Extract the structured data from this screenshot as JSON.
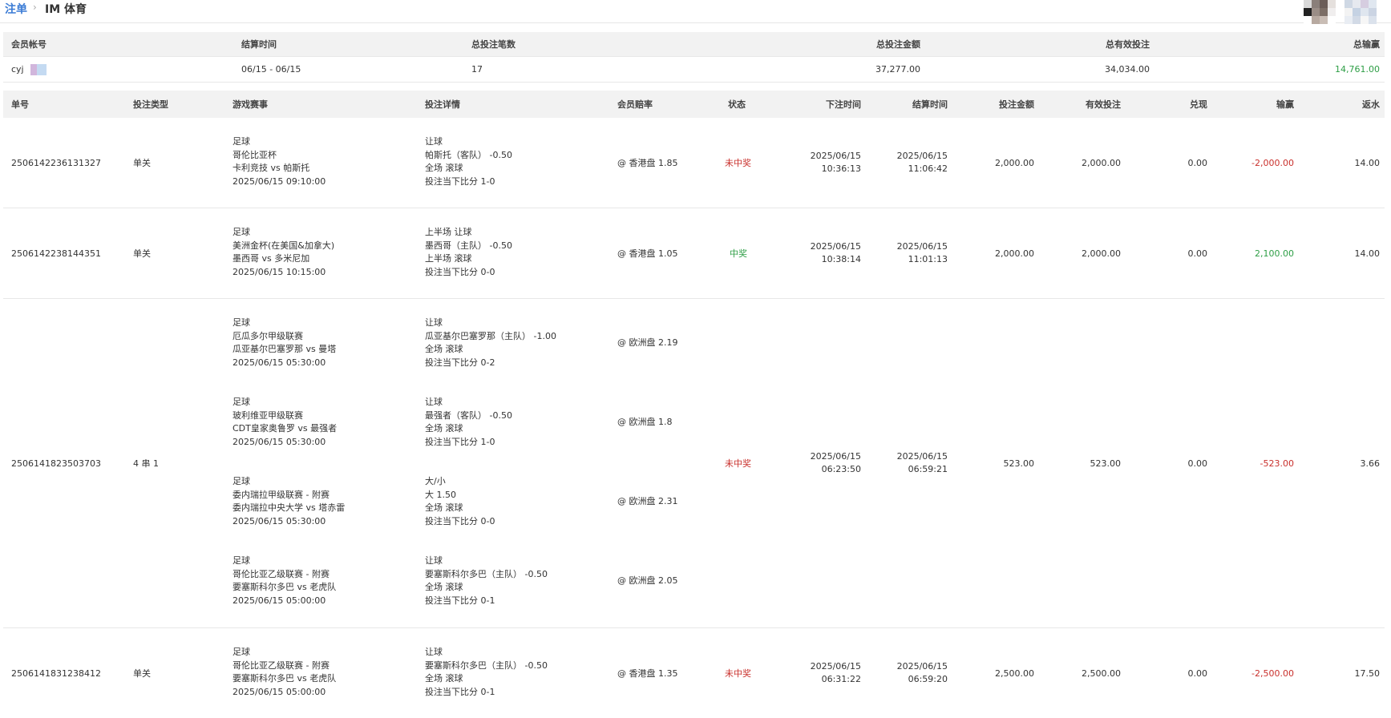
{
  "breadcrumb": {
    "link": "注单",
    "separator": "›",
    "current": "IM 体育"
  },
  "summary": {
    "headers": [
      "会员帐号",
      "结算时间",
      "总投注笔数",
      "总投注金额",
      "总有效投注",
      "总输赢"
    ],
    "account": "cyj",
    "settle_range": "06/15 - 06/15",
    "bet_count": "17",
    "total_bet": "37,277.00",
    "total_valid": "34,034.00",
    "total_winloss": "14,761.00"
  },
  "bets": {
    "headers": [
      "单号",
      "投注类型",
      "游戏赛事",
      "投注详情",
      "会员赔率",
      "状态",
      "下注时间",
      "结算时间",
      "投注金额",
      "有效投注",
      "兑现",
      "输赢",
      "返水"
    ],
    "rows": [
      {
        "id": "2506142236131327",
        "type": "单关",
        "status": "未中奖",
        "bet_date": "2025/06/15",
        "bet_time": "10:36:13",
        "settle_date": "2025/06/15",
        "settle_time": "11:06:42",
        "amount": "2,000.00",
        "valid": "2,000.00",
        "cashout": "0.00",
        "winloss": "-2,000.00",
        "rebate": "14.00",
        "legs": [
          {
            "sport": "足球",
            "league": "哥伦比亚杯",
            "match": "卡利竞技 vs 帕斯托",
            "time": "2025/06/15 09:10:00",
            "market": "让球",
            "selection": "帕斯托（客队） -0.50",
            "period": "全场 滚球",
            "score": "投注当下比分 1-0",
            "odds": "@ 香港盘 1.85"
          }
        ]
      },
      {
        "id": "2506142238144351",
        "type": "单关",
        "status": "中奖",
        "bet_date": "2025/06/15",
        "bet_time": "10:38:14",
        "settle_date": "2025/06/15",
        "settle_time": "11:01:13",
        "amount": "2,000.00",
        "valid": "2,000.00",
        "cashout": "0.00",
        "winloss": "2,100.00",
        "rebate": "14.00",
        "legs": [
          {
            "sport": "足球",
            "league": "美洲金杯(在美国&加拿大)",
            "match": "墨西哥 vs 多米尼加",
            "time": "2025/06/15 10:15:00",
            "market": "上半场 让球",
            "selection": "墨西哥（主队） -0.50",
            "period": "上半场 滚球",
            "score": "投注当下比分 0-0",
            "odds": "@ 香港盘 1.05"
          }
        ]
      },
      {
        "id": "2506141823503703",
        "type": "4 串 1",
        "status": "未中奖",
        "bet_date": "2025/06/15",
        "bet_time": "06:23:50",
        "settle_date": "2025/06/15",
        "settle_time": "06:59:21",
        "amount": "523.00",
        "valid": "523.00",
        "cashout": "0.00",
        "winloss": "-523.00",
        "rebate": "3.66",
        "legs": [
          {
            "sport": "足球",
            "league": "厄瓜多尔甲级联赛",
            "match": "瓜亚基尔巴塞罗那 vs 曼塔",
            "time": "2025/06/15 05:30:00",
            "market": "让球",
            "selection": "瓜亚基尔巴塞罗那（主队） -1.00",
            "period": "全场 滚球",
            "score": "投注当下比分 0-2",
            "odds": "@ 欧洲盘 2.19"
          },
          {
            "sport": "足球",
            "league": "玻利维亚甲级联赛",
            "match": "CDT皇家奥鲁罗 vs 最强者",
            "time": "2025/06/15 05:30:00",
            "market": "让球",
            "selection": "最强者（客队） -0.50",
            "period": "全场 滚球",
            "score": "投注当下比分 1-0",
            "odds": "@ 欧洲盘 1.8"
          },
          {
            "sport": "足球",
            "league": "委内瑞拉甲级联赛 - 附赛",
            "match": "委内瑞拉中央大学 vs 塔赤雷",
            "time": "2025/06/15 05:30:00",
            "market": "大/小",
            "selection": "大 1.50",
            "period": "全场 滚球",
            "score": "投注当下比分 0-0",
            "odds": "@ 欧洲盘 2.31"
          },
          {
            "sport": "足球",
            "league": "哥伦比亚乙级联赛 - 附赛",
            "match": "要塞斯科尔多巴 vs 老虎队",
            "time": "2025/06/15 05:00:00",
            "market": "让球",
            "selection": "要塞斯科尔多巴（主队） -0.50",
            "period": "全场 滚球",
            "score": "投注当下比分 0-1",
            "odds": "@ 欧洲盘 2.05"
          }
        ]
      },
      {
        "id": "2506141831238412",
        "type": "单关",
        "status": "未中奖",
        "bet_date": "2025/06/15",
        "bet_time": "06:31:22",
        "settle_date": "2025/06/15",
        "settle_time": "06:59:20",
        "amount": "2,500.00",
        "valid": "2,500.00",
        "cashout": "0.00",
        "winloss": "-2,500.00",
        "rebate": "17.50",
        "legs": [
          {
            "sport": "足球",
            "league": "哥伦比亚乙级联赛 - 附赛",
            "match": "要塞斯科尔多巴 vs 老虎队",
            "time": "2025/06/15 05:00:00",
            "market": "让球",
            "selection": "要塞斯科尔多巴（主队） -0.50",
            "period": "全场 滚球",
            "score": "投注当下比分 0-1",
            "odds": "@ 香港盘 1.35"
          }
        ]
      }
    ]
  }
}
